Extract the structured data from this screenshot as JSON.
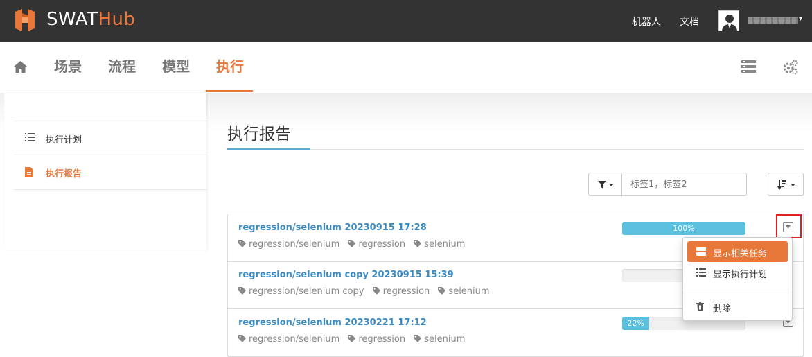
{
  "app": {
    "brand_main": "SWAT",
    "brand_accent": "Hub",
    "accent_color": "#e8773a"
  },
  "topbar": {
    "robots_link": "机器人",
    "docs_link": "文档",
    "user_caret": "▾"
  },
  "nav": {
    "home_icon": "home-icon",
    "items": [
      {
        "label": "场景"
      },
      {
        "label": "流程"
      },
      {
        "label": "模型"
      },
      {
        "label": "执行",
        "active": true
      }
    ],
    "right_icons": [
      "list-view-icon",
      "settings-gears-icon"
    ]
  },
  "sidebar": {
    "items": [
      {
        "label": "执行计划",
        "icon": "list-icon"
      },
      {
        "label": "执行报告",
        "icon": "document-icon",
        "active": true
      }
    ]
  },
  "main": {
    "title": "执行报告",
    "filter": {
      "placeholder": "标签1，标签2"
    },
    "reports": [
      {
        "title": "regression/selenium 20230915 17:28",
        "tags": [
          "regression/selenium",
          "regression",
          "selenium"
        ],
        "progress": 100,
        "progress_label": "100%"
      },
      {
        "title": "regression/selenium copy 20230915 15:39",
        "tags": [
          "regression/selenium copy",
          "regression",
          "selenium"
        ],
        "progress": 0,
        "progress_label": ""
      },
      {
        "title": "regression/selenium 20230221 17:12",
        "tags": [
          "regression/selenium",
          "regression",
          "selenium"
        ],
        "progress": 22,
        "progress_label": "22%"
      }
    ]
  },
  "dropdown": {
    "items": [
      {
        "label": "显示相关任务",
        "icon": "tasks-icon",
        "active": true
      },
      {
        "label": "显示执行计划",
        "icon": "list-icon"
      },
      {
        "label": "删除",
        "icon": "trash-icon"
      }
    ]
  }
}
